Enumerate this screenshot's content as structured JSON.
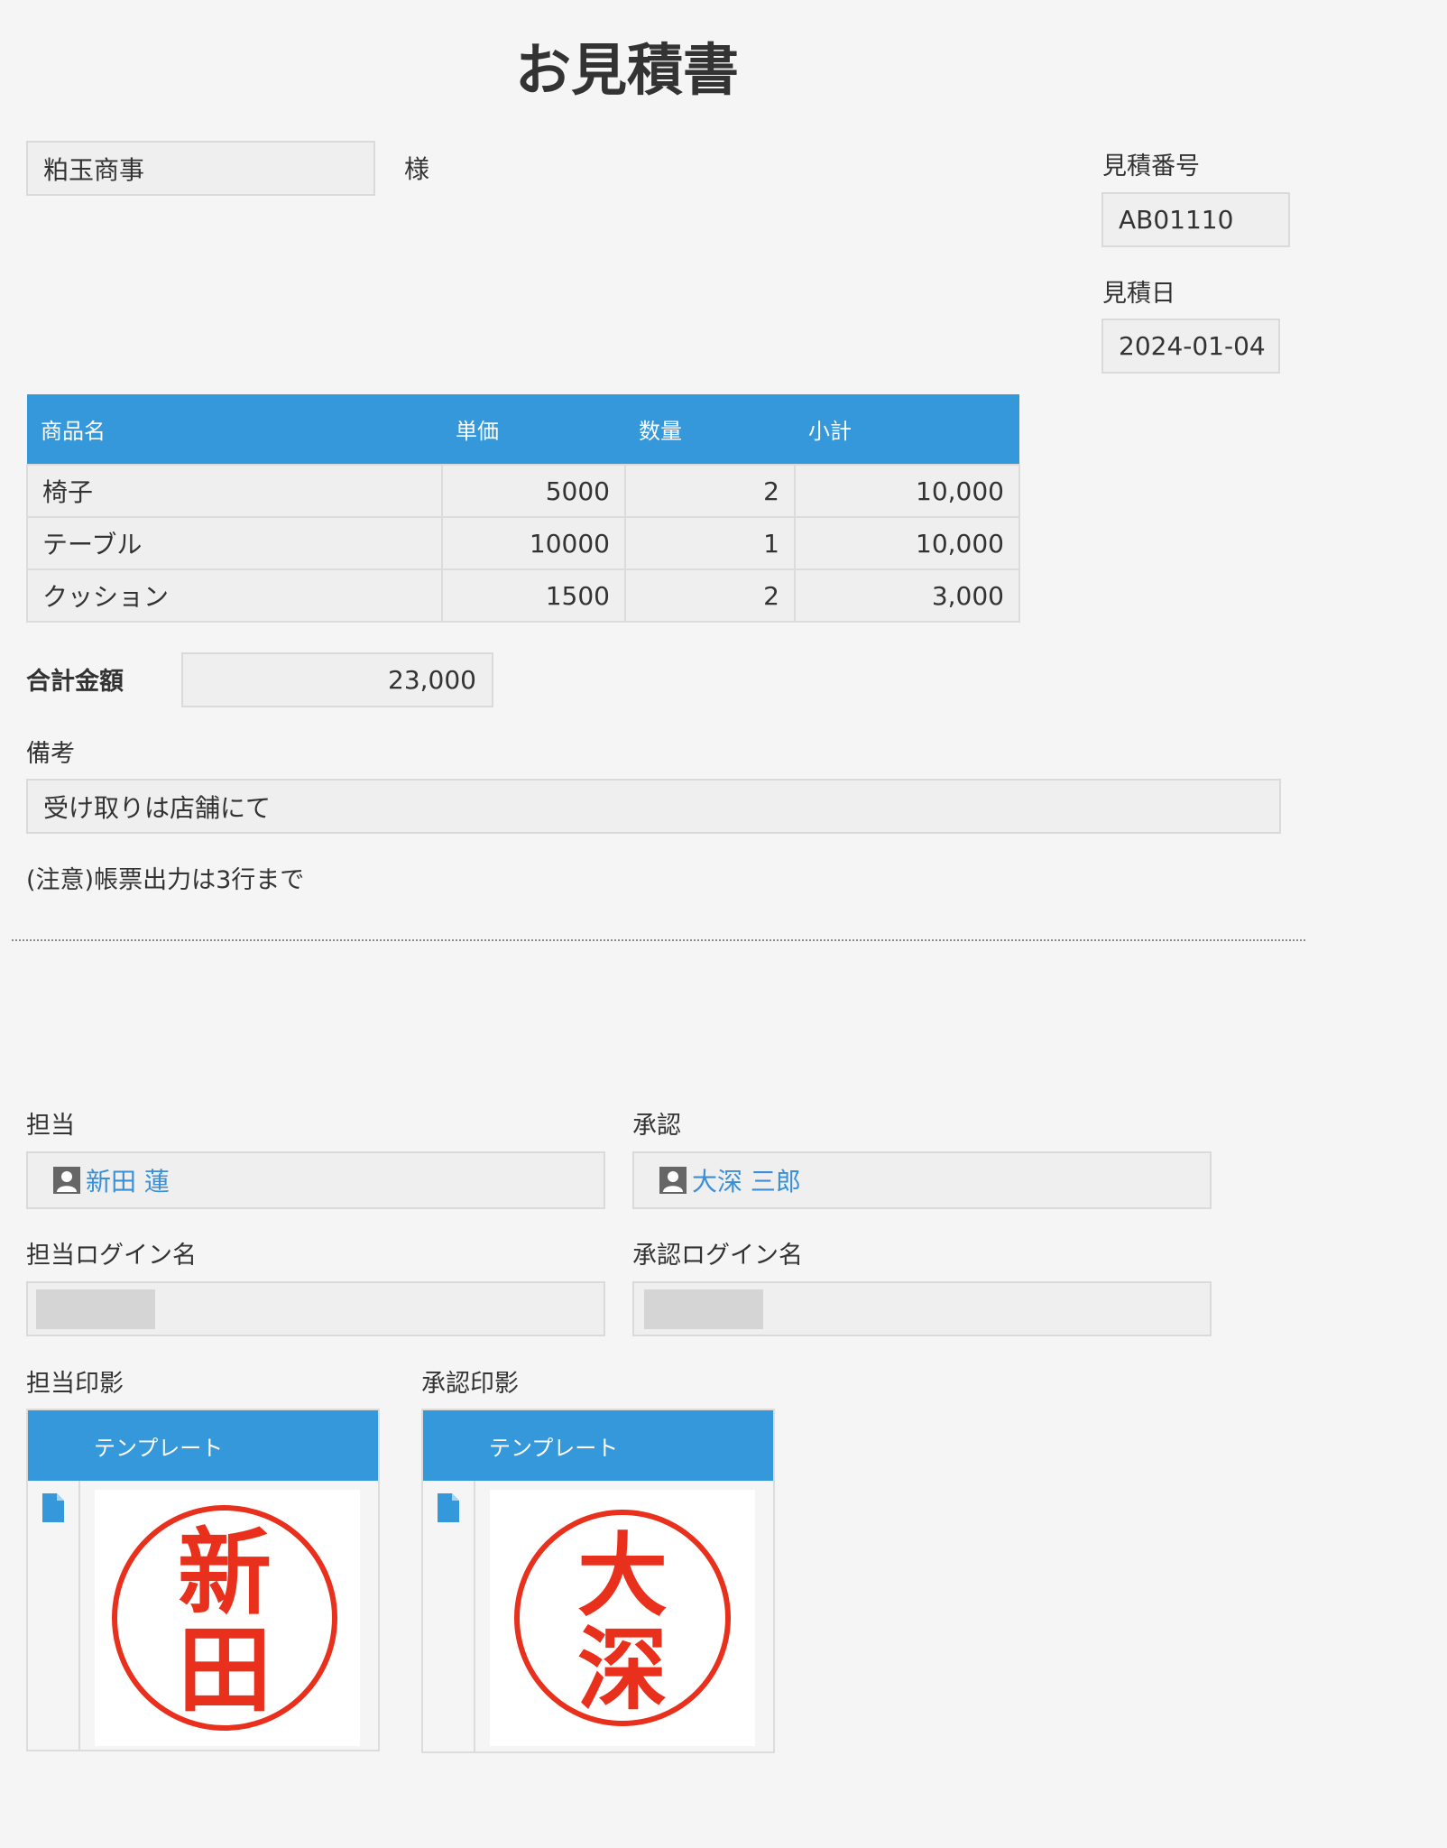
{
  "title": "お見積書",
  "customer": {
    "name": "粕玉商事",
    "honorific": "様"
  },
  "quote_number": {
    "label": "見積番号",
    "value": "AB01110"
  },
  "quote_date": {
    "label": "見積日",
    "value": "2024-01-04"
  },
  "items": {
    "headers": [
      "商品名",
      "単価",
      "数量",
      "小計"
    ],
    "rows": [
      {
        "name": "椅子",
        "unit_price": "5000",
        "qty": "2",
        "subtotal": "10,000"
      },
      {
        "name": "テーブル",
        "unit_price": "10000",
        "qty": "1",
        "subtotal": "10,000"
      },
      {
        "name": "クッション",
        "unit_price": "1500",
        "qty": "2",
        "subtotal": "3,000"
      }
    ]
  },
  "total": {
    "label": "合計金額",
    "value": "23,000"
  },
  "remarks": {
    "label": "備考",
    "value": "受け取りは店舗にて"
  },
  "note": "(注意)帳票出力は3行まで",
  "assignee": {
    "label": "担当",
    "user": "新田 蓮",
    "login_label": "担当ログイン名",
    "stamp_label": "担当印影",
    "stamp_chars": [
      "新",
      "田"
    ]
  },
  "approver": {
    "label": "承認",
    "user": "大深 三郎",
    "login_label": "承認ログイン名",
    "stamp_label": "承認印影",
    "stamp_chars": [
      "大",
      "深"
    ]
  },
  "stamp_table": {
    "header": "テンプレート"
  },
  "colors": {
    "accent": "#3498db",
    "link": "#3a8fd6",
    "stamp_red": "#e8301c"
  },
  "icons": {
    "user": "user-icon",
    "file": "file-icon"
  }
}
